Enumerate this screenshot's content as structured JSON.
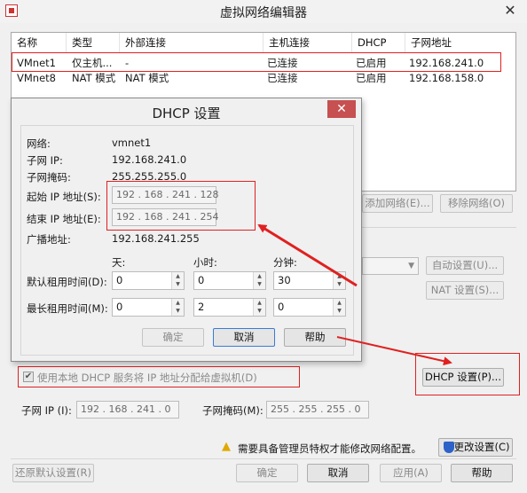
{
  "window": {
    "title": "虚拟网络编辑器",
    "close": "✕"
  },
  "table": {
    "headers": [
      "名称",
      "类型",
      "外部连接",
      "主机连接",
      "DHCP",
      "子网地址"
    ],
    "rows": [
      {
        "name": "VMnet1",
        "type": "仅主机...",
        "external": "-",
        "host": "已连接",
        "dhcp": "已启用",
        "subnet": "192.168.241.0"
      },
      {
        "name": "VMnet8",
        "type": "NAT 模式",
        "external": "NAT 模式",
        "host": "已连接",
        "dhcp": "已启用",
        "subnet": "192.168.158.0"
      }
    ]
  },
  "side_buttons": {
    "add_network": "添加网络(E)...",
    "remove_network": "移除网络(O)",
    "auto_settings": "自动设置(U)...",
    "nat_settings": "NAT 设置(S)...",
    "dhcp_settings": "DHCP 设置(P)..."
  },
  "dhcp_checkbox": {
    "label": "使用本地 DHCP 服务将 IP 地址分配给虚拟机(D)",
    "check": "✔"
  },
  "subnet": {
    "ip_label": "子网 IP (I):",
    "ip_value": "192 . 168 . 241 .  0",
    "mask_label": "子网掩码(M):",
    "mask_value": "255 . 255 . 255 .  0"
  },
  "admin": {
    "warning_icon": "▲",
    "warning_text": "需要具备管理员特权才能修改网络配置。",
    "change_button": "更改设置(C)"
  },
  "bottom_buttons": {
    "restore": "还原默认设置(R)",
    "ok": "确定",
    "cancel": "取消",
    "apply": "应用(A)",
    "help": "帮助"
  },
  "dhcp_dialog": {
    "title": "DHCP 设置",
    "close": "✕",
    "network_label": "网络:",
    "network_value": "vmnet1",
    "subnet_ip_label": "子网 IP:",
    "subnet_ip_value": "192.168.241.0",
    "subnet_mask_label": "子网掩码:",
    "subnet_mask_value": "255.255.255.0",
    "start_ip_label": "起始 IP 地址(S):",
    "start_ip_value": "192 . 168 . 241 . 128",
    "end_ip_label": "结束 IP 地址(E):",
    "end_ip_value": "192 . 168 . 241 . 254",
    "broadcast_label": "广播地址:",
    "broadcast_value": "192.168.241.255",
    "days_label": "天:",
    "hours_label": "小时:",
    "minutes_label": "分钟:",
    "default_lease_label": "默认租用时间(D):",
    "default_lease": {
      "days": "0",
      "hours": "0",
      "minutes": "30"
    },
    "max_lease_label": "最长租用时间(M):",
    "max_lease": {
      "days": "0",
      "hours": "2",
      "minutes": "0"
    },
    "ok": "确定",
    "cancel": "取消",
    "help": "帮助"
  },
  "colors": {
    "highlight_red": "#e02020",
    "arrow_red": "#e02020",
    "close_red": "#c75050"
  }
}
